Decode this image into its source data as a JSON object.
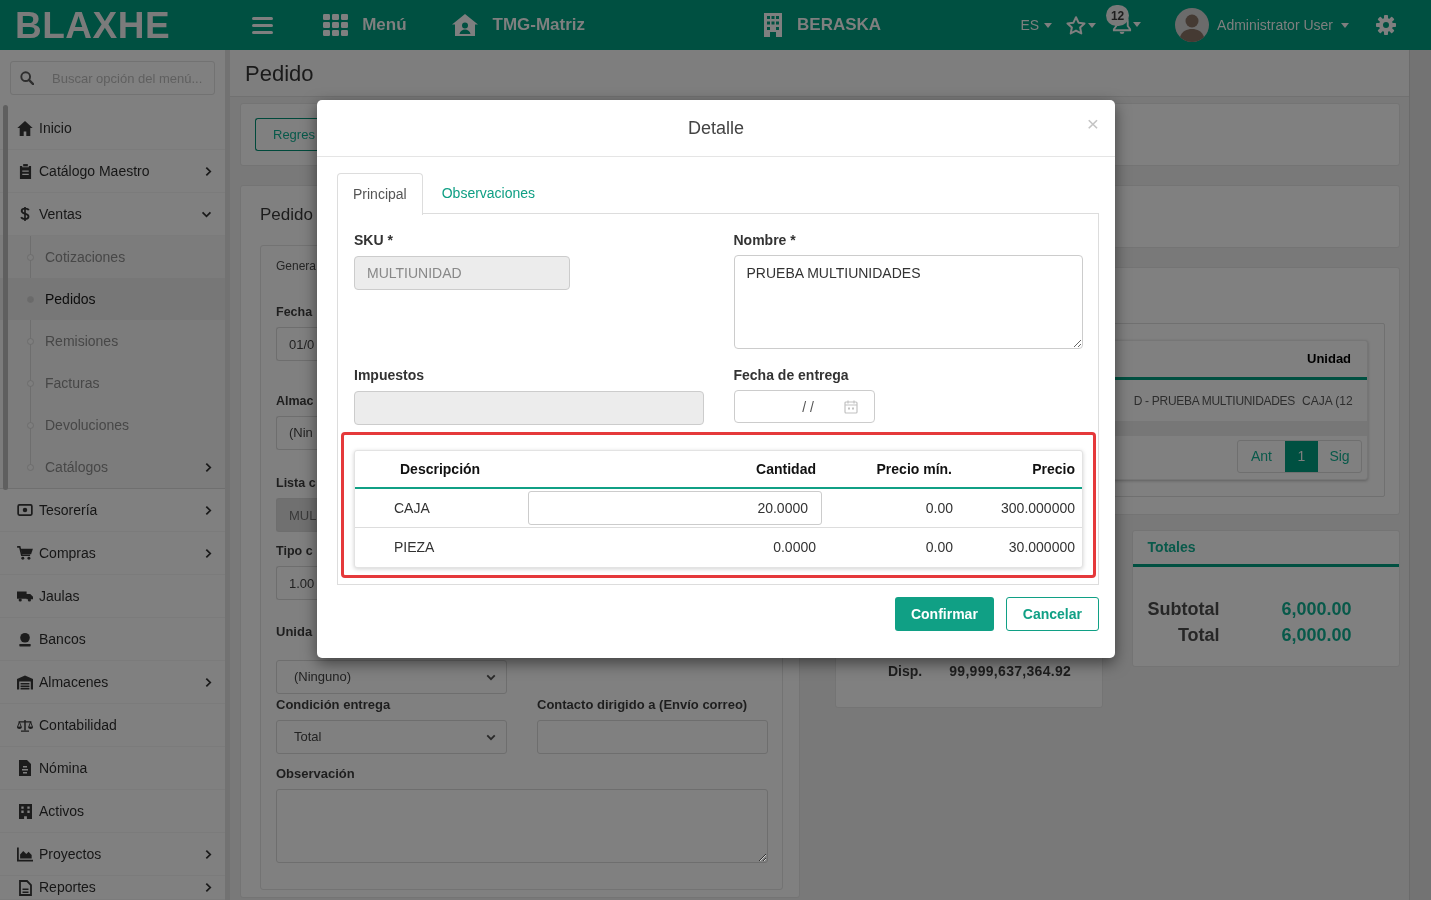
{
  "topbar": {
    "logo": "BLAXHE",
    "menu_label": "Menú",
    "branch": "TMG-Matriz",
    "company": "BERASKA",
    "language": "ES",
    "notification_count": "12",
    "user_name": "Administrator User"
  },
  "sidebar": {
    "search_placeholder": "Buscar opción del menú...",
    "items": [
      {
        "label": "Inicio",
        "kind": "link",
        "expanded": false,
        "selected": false
      },
      {
        "label": "Catálogo Maestro",
        "kind": "group",
        "expanded": false,
        "selected": false
      },
      {
        "label": "Ventas",
        "kind": "group",
        "expanded": true,
        "selected": false,
        "children": [
          {
            "label": "Cotizaciones",
            "kind": "link",
            "selected": false
          },
          {
            "label": "Pedidos",
            "kind": "link",
            "selected": true
          },
          {
            "label": "Remisiones",
            "kind": "link",
            "selected": false
          },
          {
            "label": "Facturas",
            "kind": "link",
            "selected": false
          },
          {
            "label": "Devoluciones",
            "kind": "link",
            "selected": false
          },
          {
            "label": "Catálogos",
            "kind": "group",
            "selected": false
          }
        ]
      },
      {
        "label": "Tesorería",
        "kind": "group",
        "expanded": false,
        "selected": false
      },
      {
        "label": "Compras",
        "kind": "group",
        "expanded": false,
        "selected": false
      },
      {
        "label": "Jaulas",
        "kind": "link",
        "expanded": false,
        "selected": false
      },
      {
        "label": "Bancos",
        "kind": "link",
        "expanded": false,
        "selected": false
      },
      {
        "label": "Almacenes",
        "kind": "group",
        "expanded": false,
        "selected": false
      },
      {
        "label": "Contabilidad",
        "kind": "link",
        "expanded": false,
        "selected": false
      },
      {
        "label": "Nómina",
        "kind": "link",
        "expanded": false,
        "selected": false
      },
      {
        "label": "Activos",
        "kind": "link",
        "expanded": false,
        "selected": false
      },
      {
        "label": "Proyectos",
        "kind": "group",
        "expanded": false,
        "selected": false
      },
      {
        "label": "Reportes",
        "kind": "group",
        "expanded": false,
        "selected": false
      }
    ]
  },
  "page": {
    "title": "Pedido",
    "back_button": "Regres",
    "order_card": {
      "title": "Pedido",
      "tabs": [
        {
          "label": "Genera",
          "selected": true
        }
      ],
      "rows": [
        [
          {
            "label": "Fecha",
            "kind": "input",
            "value": "01/0",
            "disabled": false
          }
        ],
        [
          {
            "label": "Almac",
            "kind": "select",
            "value": "(Nin",
            "disabled": false
          }
        ],
        [
          {
            "label": "Lista c",
            "kind": "input",
            "value": "MUL",
            "disabled": true
          }
        ],
        [
          {
            "label": "Tipo c",
            "kind": "input",
            "value": "1.00",
            "disabled": false
          }
        ],
        [
          {
            "label": "Unida",
            "kind": "select",
            "value": "(Ninguno)",
            "disabled": false
          }
        ],
        [
          {
            "label": "Condición entrega",
            "kind": "select",
            "value": "Total",
            "disabled": false
          },
          {
            "label": "Contacto dirigido a (Envío correo)",
            "kind": "input",
            "disabled": false
          }
        ],
        [
          {
            "label": "Observación",
            "kind": "textarea",
            "disabled": false
          }
        ]
      ]
    },
    "items_table": {
      "columns": [
        "",
        "Unidad"
      ],
      "rows": [
        [
          "D - PRUEBA MULTIUNIDADES",
          "CAJA (12"
        ]
      ],
      "pagination": [
        {
          "label": "Ant",
          "selected": false
        },
        {
          "label": "1",
          "selected": true
        },
        {
          "label": "Sig",
          "selected": false
        }
      ]
    },
    "availability": {
      "label": "Disp.",
      "value": "99,999,637,364.92"
    },
    "totals": {
      "title": "Totales",
      "rows": [
        {
          "label": "Subtotal",
          "value": "6,000.00"
        },
        {
          "label": "Total",
          "value": "6,000.00"
        }
      ]
    }
  },
  "modal": {
    "title": "Detalle",
    "close": "×",
    "tabs": [
      {
        "label": "Principal",
        "selected": true
      },
      {
        "label": "Observaciones",
        "selected": false
      }
    ],
    "fields": [
      {
        "label": "SKU *",
        "kind": "input",
        "value": "MULTIUNIDAD",
        "disabled": true
      },
      {
        "label": "Nombre *",
        "kind": "textarea",
        "value": "PRUEBA MULTIUNIDADES",
        "disabled": false
      },
      {
        "label": "Impuestos",
        "kind": "input",
        "disabled": true
      },
      {
        "label": "Fecha de entrega",
        "kind": "date",
        "placeholder": "/ /",
        "disabled": false
      }
    ],
    "table": {
      "highlighted": true,
      "columns": [
        "Descripción",
        "Cantidad",
        "Precio mín.",
        "Precio"
      ],
      "rows": [
        {
          "kind": "editable",
          "cells": [
            "CAJA",
            "20.0000",
            "0.00",
            "300.000000"
          ]
        },
        {
          "kind": "static",
          "cells": [
            "PIEZA",
            "0.0000",
            "0.00",
            "30.000000"
          ]
        }
      ]
    },
    "buttons": [
      {
        "label": "Confirmar",
        "kind": "primary"
      },
      {
        "label": "Cancelar",
        "kind": "secondary"
      }
    ]
  }
}
